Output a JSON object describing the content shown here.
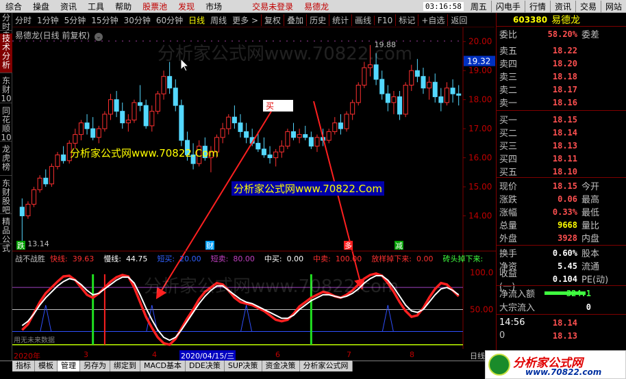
{
  "menu": [
    "综合",
    "操盘",
    "资讯",
    "工具",
    "帮助",
    "股票池",
    "发现",
    "市场"
  ],
  "menu_red": [
    "股票池",
    "发现"
  ],
  "login": "交易未登录",
  "login_name": "易德龙",
  "clock": "03:16:58",
  "weekday": "周五",
  "quick_buttons": [
    "闪电手",
    "行情",
    "资讯",
    "交易",
    "网站"
  ],
  "side_tabs": [
    "分时走势",
    "技术分析",
    "东财10",
    "同花顺10",
    "龙虎榜",
    "东财股吧",
    "精品公式"
  ],
  "toolbar": {
    "periods": [
      "分时",
      "1分钟",
      "5分钟",
      "15分钟",
      "30分钟",
      "60分钟",
      "日线",
      "周线",
      "更多 >"
    ],
    "active": "日线",
    "tools": [
      "复权",
      "叠加",
      "历史",
      "统计",
      "画线",
      "F10",
      "标记",
      "+自选",
      "返回"
    ]
  },
  "chart_title": "易德龙(日线 前复权)",
  "price_axis": {
    "labels": [
      "20.00",
      "19.00",
      "18.00",
      "17.00",
      "16.00",
      "15.00",
      "14.00"
    ],
    "current": "19.32"
  },
  "annotations": {
    "high": "19.88",
    "low": "13.14",
    "buy_label": "买"
  },
  "markers": [
    "跌",
    "财",
    "多",
    "减"
  ],
  "indicator": {
    "name": "战不战胜",
    "items": [
      {
        "label": "快线:",
        "value": "39.63",
        "color": "#ff3030"
      },
      {
        "label": "慢线:",
        "value": "44.75",
        "color": "#ffffff"
      },
      {
        "label": "短买:",
        "value": "20.00",
        "color": "#3060ff"
      },
      {
        "label": "短卖:",
        "value": "80.00",
        "color": "#c040c0"
      },
      {
        "label": "中买:",
        "value": "0.00",
        "color": "#ffffff"
      },
      {
        "label": "中卖:",
        "value": "100.00",
        "color": "#ff3030"
      },
      {
        "label": "放样掉下来:",
        "value": "0.00",
        "color": "#ff3030"
      },
      {
        "label": "砖头掉下来:",
        "value": "",
        "color": "#40ff40"
      }
    ],
    "axis": [
      "100.0",
      "50.00"
    ],
    "note": "用无未来数据"
  },
  "x_axis": {
    "labels": [
      "2020年",
      "3",
      "4",
      "5",
      "6",
      "7",
      "8"
    ],
    "cursor_date": "2020/04/15/三",
    "period": "日线"
  },
  "bottom_tabs": [
    "指标",
    "模板",
    "管理",
    "另存为",
    "绑定到",
    "MACD基本",
    "DDE决策",
    "SUP决策",
    "资金决策",
    "分析家公式网"
  ],
  "bottom_active": "管理",
  "quote": {
    "code": "603380",
    "name": "易德龙",
    "weibi_label": "委比",
    "weibi": "58.20%",
    "weicha_label": "委差",
    "asks": [
      {
        "label": "卖五",
        "price": "18.22"
      },
      {
        "label": "卖四",
        "price": "18.20"
      },
      {
        "label": "卖三",
        "price": "18.18"
      },
      {
        "label": "卖二",
        "price": "18.17"
      },
      {
        "label": "卖一",
        "price": "18.16"
      }
    ],
    "bids": [
      {
        "label": "买一",
        "price": "18.15"
      },
      {
        "label": "买二",
        "price": "18.14"
      },
      {
        "label": "买三",
        "price": "18.13"
      },
      {
        "label": "买四",
        "price": "18.11"
      },
      {
        "label": "买五",
        "price": "18.10"
      }
    ],
    "stats": [
      {
        "label": "现价",
        "value": "18.15",
        "right": "今开"
      },
      {
        "label": "涨跌",
        "value": "0.06",
        "right": "最高"
      },
      {
        "label": "涨幅",
        "value": "0.33%",
        "right": "最低"
      },
      {
        "label": "总量",
        "value": "9668",
        "right": "量比"
      },
      {
        "label": "外盘",
        "value": "3928",
        "right": "内盘"
      }
    ],
    "stats2": [
      {
        "label": "换手",
        "value": "0.60%",
        "right": "股本"
      },
      {
        "label": "净资",
        "value": "5.45",
        "right": "流通"
      },
      {
        "label": "收益(一)",
        "value": "0.104",
        "right": "PE(动)"
      }
    ],
    "flow": [
      {
        "label": "净流入额",
        "value": "-324.1"
      },
      {
        "label": "大宗流入",
        "value": "0"
      }
    ],
    "tick_time": "14:56",
    "tick_price1": "18.14",
    "tick_price2": "18.13"
  },
  "watermarks": [
    "分析家公式网www.70822.com",
    "分析家公式网www.70822.Com",
    "分析家公式网www.70822.Com",
    "分析家公式网www.70822.com"
  ],
  "logo": {
    "title": "分析家公式网",
    "url": "www.70822.com"
  },
  "colors": {
    "up": "#ff3030",
    "down": "#54d8ff",
    "panel_border": "#800000",
    "highlight": "#ffff00"
  },
  "chart_data": {
    "type": "candlestick",
    "yrange": [
      13.0,
      20.3
    ],
    "ohlc": [
      [
        14.3,
        14.6,
        13.14,
        14.0
      ],
      [
        14.0,
        14.5,
        13.9,
        14.4
      ],
      [
        14.4,
        15.0,
        14.3,
        14.9
      ],
      [
        14.9,
        15.4,
        14.8,
        15.3
      ],
      [
        15.3,
        15.6,
        15.0,
        15.1
      ],
      [
        15.1,
        15.8,
        15.0,
        15.7
      ],
      [
        15.7,
        16.2,
        15.6,
        16.1
      ],
      [
        16.1,
        16.4,
        15.8,
        15.9
      ],
      [
        15.9,
        16.6,
        15.8,
        16.5
      ],
      [
        16.5,
        17.0,
        16.3,
        16.8
      ],
      [
        16.8,
        17.3,
        16.6,
        17.2
      ],
      [
        17.2,
        17.5,
        16.8,
        17.0
      ],
      [
        17.0,
        17.4,
        16.6,
        16.7
      ],
      [
        16.7,
        17.1,
        16.5,
        17.0
      ],
      [
        17.0,
        17.6,
        16.9,
        17.5
      ],
      [
        17.5,
        18.2,
        17.3,
        18.0
      ],
      [
        18.0,
        18.3,
        17.4,
        17.6
      ],
      [
        17.6,
        17.9,
        17.0,
        17.2
      ],
      [
        17.2,
        17.5,
        16.9,
        17.3
      ],
      [
        17.3,
        18.0,
        17.2,
        17.9
      ],
      [
        17.9,
        18.5,
        17.6,
        17.8
      ],
      [
        17.8,
        18.0,
        17.0,
        17.1
      ],
      [
        17.1,
        17.8,
        16.9,
        17.6
      ],
      [
        17.6,
        18.3,
        17.5,
        18.2
      ],
      [
        18.2,
        19.0,
        18.0,
        18.8
      ],
      [
        18.8,
        19.3,
        18.2,
        18.4
      ],
      [
        18.4,
        18.7,
        17.6,
        17.8
      ],
      [
        17.8,
        18.0,
        16.4,
        16.6
      ],
      [
        16.6,
        16.9,
        15.9,
        16.1
      ],
      [
        16.1,
        16.5,
        15.6,
        15.8
      ],
      [
        15.8,
        16.6,
        15.7,
        16.4
      ],
      [
        16.4,
        16.7,
        15.9,
        16.0
      ],
      [
        16.0,
        16.4,
        15.5,
        16.2
      ],
      [
        16.2,
        16.8,
        16.0,
        16.7
      ],
      [
        16.7,
        17.2,
        16.5,
        17.0
      ],
      [
        17.0,
        17.5,
        16.8,
        17.4
      ],
      [
        17.4,
        17.8,
        17.0,
        17.2
      ],
      [
        17.2,
        17.5,
        16.7,
        16.9
      ],
      [
        16.9,
        17.2,
        16.5,
        16.7
      ],
      [
        16.7,
        17.0,
        16.4,
        16.5
      ],
      [
        16.5,
        16.9,
        16.2,
        16.3
      ],
      [
        16.3,
        16.7,
        16.0,
        16.1
      ],
      [
        16.1,
        16.4,
        15.8,
        16.0
      ],
      [
        16.0,
        16.3,
        15.7,
        16.2
      ],
      [
        16.2,
        16.6,
        16.0,
        16.4
      ],
      [
        16.4,
        17.0,
        16.3,
        16.9
      ],
      [
        16.9,
        17.2,
        16.6,
        16.7
      ],
      [
        16.7,
        17.0,
        16.5,
        16.8
      ],
      [
        16.8,
        17.1,
        16.6,
        16.7
      ],
      [
        16.7,
        16.9,
        16.3,
        16.4
      ],
      [
        16.4,
        16.8,
        16.2,
        16.7
      ],
      [
        16.7,
        17.0,
        16.4,
        16.6
      ],
      [
        16.6,
        17.0,
        16.5,
        16.9
      ],
      [
        16.9,
        17.4,
        16.8,
        17.2
      ],
      [
        17.2,
        17.5,
        16.8,
        17.0
      ],
      [
        17.0,
        17.6,
        16.9,
        17.5
      ],
      [
        17.5,
        18.0,
        17.3,
        17.9
      ],
      [
        17.9,
        18.6,
        17.8,
        18.5
      ],
      [
        18.5,
        19.3,
        18.4,
        19.1
      ],
      [
        19.1,
        19.88,
        18.8,
        19.2
      ],
      [
        19.2,
        19.6,
        18.5,
        18.7
      ],
      [
        18.7,
        19.0,
        18.0,
        18.2
      ],
      [
        18.2,
        18.5,
        17.6,
        17.9
      ],
      [
        17.9,
        18.3,
        17.5,
        18.1
      ],
      [
        18.1,
        18.3,
        17.3,
        17.5
      ],
      [
        17.5,
        18.6,
        17.4,
        18.5
      ],
      [
        18.5,
        19.2,
        18.3,
        19.0
      ],
      [
        19.0,
        19.4,
        18.6,
        18.8
      ],
      [
        18.8,
        19.1,
        18.2,
        18.4
      ],
      [
        18.4,
        18.8,
        18.0,
        18.6
      ],
      [
        18.6,
        18.9,
        17.9,
        18.1
      ],
      [
        18.1,
        18.4,
        17.6,
        17.9
      ],
      [
        17.9,
        18.6,
        17.8,
        18.4
      ],
      [
        18.4,
        18.7,
        17.9,
        18.2
      ],
      [
        18.2,
        18.5,
        17.8,
        18.15
      ]
    ],
    "indicator_fast": [
      22,
      30,
      45,
      60,
      72,
      80,
      88,
      95,
      96,
      90,
      80,
      70,
      66,
      72,
      80,
      88,
      94,
      97,
      95,
      80,
      60,
      40,
      25,
      12,
      4,
      2,
      10,
      24,
      38,
      50,
      64,
      74,
      80,
      86,
      84,
      76,
      66,
      60,
      58,
      56,
      52,
      48,
      42,
      36,
      34,
      36,
      44,
      54,
      60,
      66,
      70,
      74,
      72,
      68,
      66,
      70,
      76,
      84,
      92,
      97,
      99,
      96,
      86,
      74,
      60,
      48,
      40,
      42,
      52,
      66,
      78,
      86,
      84,
      76,
      68
    ],
    "indicator_slow": [
      28,
      34,
      44,
      56,
      66,
      74,
      82,
      88,
      92,
      90,
      84,
      76,
      70,
      72,
      78,
      84,
      90,
      94,
      94,
      86,
      70,
      52,
      36,
      22,
      12,
      8,
      12,
      22,
      34,
      46,
      58,
      68,
      76,
      82,
      82,
      76,
      70,
      64,
      60,
      58,
      54,
      50,
      46,
      42,
      38,
      38,
      42,
      50,
      56,
      62,
      66,
      70,
      70,
      68,
      66,
      68,
      72,
      78,
      86,
      92,
      96,
      96,
      90,
      80,
      68,
      56,
      48,
      46,
      50,
      60,
      70,
      78,
      80,
      76,
      70
    ],
    "indicator_axis": [
      0,
      110
    ],
    "buy_bars": [
      12,
      49
    ],
    "sell_bars": [
      14
    ]
  }
}
